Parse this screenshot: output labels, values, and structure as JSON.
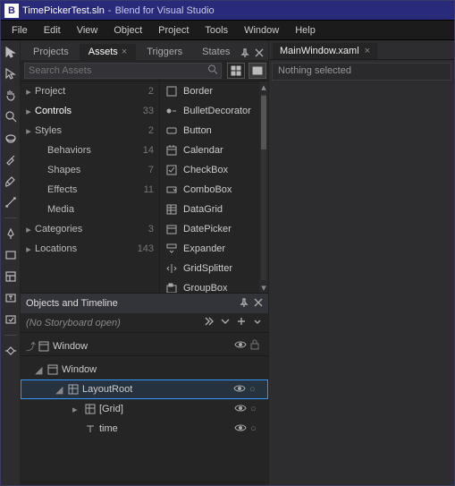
{
  "title": {
    "file": "TimePickerTest.sln",
    "app": "Blend for Visual Studio"
  },
  "menu": [
    "File",
    "Edit",
    "View",
    "Object",
    "Project",
    "Tools",
    "Window",
    "Help"
  ],
  "panel_tabs": {
    "items": [
      "Projects",
      "Assets",
      "Triggers",
      "States"
    ],
    "active": "Assets"
  },
  "search": {
    "placeholder": "Search Assets"
  },
  "categories": [
    {
      "label": "Project",
      "count": 2,
      "arrow": "▸",
      "sub": false
    },
    {
      "label": "Controls",
      "count": 33,
      "arrow": "▸",
      "sub": false,
      "sel": true
    },
    {
      "label": "Styles",
      "count": 2,
      "arrow": "▸",
      "sub": false
    },
    {
      "label": "Behaviors",
      "count": 14,
      "arrow": "",
      "sub": true
    },
    {
      "label": "Shapes",
      "count": 7,
      "arrow": "",
      "sub": true
    },
    {
      "label": "Effects",
      "count": 11,
      "arrow": "",
      "sub": true
    },
    {
      "label": "Media",
      "count": "",
      "arrow": "",
      "sub": true
    },
    {
      "label": "Categories",
      "count": 3,
      "arrow": "▸",
      "sub": false
    },
    {
      "label": "Locations",
      "count": 143,
      "arrow": "▸",
      "sub": false
    }
  ],
  "controls": [
    "Border",
    "BulletDecorator",
    "Button",
    "Calendar",
    "CheckBox",
    "ComboBox",
    "DataGrid",
    "DatePicker",
    "Expander",
    "GridSplitter",
    "GroupBox"
  ],
  "objects": {
    "header": "Objects and Timeline",
    "storyboard": "(No Storyboard open)",
    "root": "Window",
    "tree": [
      {
        "label": "Window",
        "level": 1,
        "exp": "◢",
        "icon": "window",
        "eye": false
      },
      {
        "label": "LayoutRoot",
        "level": 2,
        "exp": "◢",
        "icon": "grid",
        "eye": true,
        "sel": true
      },
      {
        "label": "[Grid]",
        "level": 3,
        "exp": "▸",
        "icon": "grid",
        "eye": true
      },
      {
        "label": "time",
        "level": 3,
        "exp": "",
        "icon": "text",
        "eye": true
      }
    ]
  },
  "docs": {
    "tabs": [
      "MainWindow.xaml"
    ]
  },
  "props": {
    "selection": "Nothing selected"
  }
}
